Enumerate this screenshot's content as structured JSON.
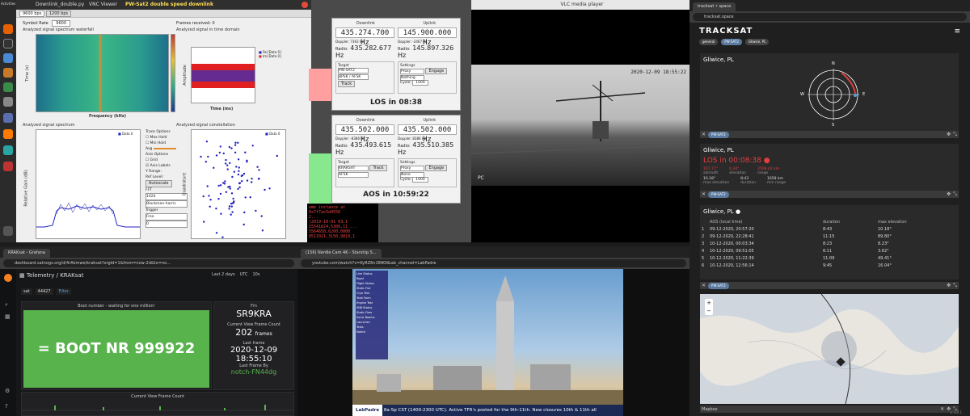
{
  "taskbar": {
    "label": "Activities",
    "icons": [
      "firefox-icon",
      "terminal-icon",
      "chrome-icon",
      "files-icon",
      "gnuradio-icon",
      "settings-icon",
      "text-editor-icon",
      "vlc-icon",
      "sdr-icon",
      "screenshot-icon",
      "apps-icon"
    ]
  },
  "gnuradio": {
    "window_title": "VNC Viewer",
    "file_tab": "Downlink_double.py",
    "title": "PW-Sat2 double speed downlink",
    "tabs": [
      "9600 bps",
      "1200 bps"
    ],
    "symbol_rate_label": "Symbol Rate",
    "symbol_rate": "9600",
    "frames_label": "Frames received: 0",
    "waterfall_title": "Analyzed signal spectrum waterfall",
    "waterfall_xlabel": "Frequency (kHz)",
    "waterfall_ylabel": "Time (s)",
    "time_title": "Analyzed signal in time domain",
    "time_xlabel": "Time (ms)",
    "time_ylabel": "Amplitude",
    "time_legend": [
      "Re{Data 0}",
      "Im{Data 0}"
    ],
    "spec_title": "Analyzed signal spectrum",
    "spec_ylabel": "Relative Gain (dB)",
    "spec_legend": "Data 0",
    "trace_options": "Trace Options",
    "max_hold": "Max Hold",
    "min_hold": "Min Hold",
    "avg": "Avg",
    "axis_options": "Axis Options",
    "grid": "Grid",
    "axis_labels": "Axis Labels",
    "y_range": "Y Range:",
    "ref_level": "Ref Level:",
    "autoscale": "Autoscale",
    "fft": "FFT",
    "fft_size": "1024",
    "window": "Blackman-harris",
    "trigger": "Trigger",
    "trigger_mode": "Free",
    "trigger_level": "0",
    "const_title": "Analyzed signal constellation",
    "const_ylabel": "Quadrature",
    "const_legend": "Data 0"
  },
  "doppler1": {
    "downlink": "Downlink",
    "uplink": "Uplink",
    "down_freq": "435.274.700 Hz",
    "up_freq": "145.900.000 Hz",
    "doppler_label": "Doppler:",
    "down_doppler": "7363 Hz",
    "up_doppler": "-2467 Hz",
    "radio_label": "Radio:",
    "down_radio": "435.282.677 Hz",
    "up_radio": "145.897.326 Hz",
    "target": "Target",
    "settings": "Settings",
    "sat": "PW-SAT2",
    "mode": "BPSK / AFSK",
    "track": "Track",
    "cycle": "Cycle:",
    "cycle_val": "1000",
    "engage": "Engage",
    "rx": "Proxy",
    "tx": "Nothing",
    "los": "LOS in 08:38"
  },
  "doppler2": {
    "downlink": "Downlink",
    "uplink": "Uplink",
    "down_freq": "435.502.000 Hz",
    "up_freq": "435.502.000 Hz",
    "doppler_label": "Doppler:",
    "down_doppler": "-8386 Hz",
    "up_doppler": "8386 Hz",
    "radio_label": "Radio:",
    "down_radio": "435.493.615 Hz",
    "up_radio": "435.510.385 Hz",
    "target": "Target",
    "settings": "Settings",
    "sat": "KRAKSAT",
    "mode": "AFSK",
    "track": "Track",
    "cycle": "Cycle:",
    "cycle_val": "1000",
    "engage": "Engage",
    "rx": "Proxy",
    "tx": "None",
    "los": "AOS in 10:59:22"
  },
  "terminal": {
    "lines": [
      "ame instance at 0x7f7ac5d4556",
      "",
      "2...",
      "(2019-10-01 03:1",
      "15541024,5300,11 ...",
      "5564658,6200,0000",
      "0511021,3150,9810,1"
    ]
  },
  "vlc": {
    "title": "VLC media player",
    "timestamp": "2020-12-09 18:55:22",
    "watermark": "PC"
  },
  "tracksat": {
    "tab_title": "tracksat • space",
    "url": "tracksat.space",
    "logo": "TRACKSAT",
    "filter_general": "general",
    "filter_sat": "PW-SAT2",
    "filter_loc": "Gliwice, PL",
    "polar_title": "Gliwice, PL",
    "compass": [
      "N",
      "E",
      "S",
      "W"
    ],
    "chip_sat": "PW-SAT2",
    "los_title": "Gliwice, PL",
    "los_text": "LOS in 00:08:38",
    "stats1": [
      {
        "value": "107.77°",
        "label": "azimuth"
      },
      {
        "value": "0.34°",
        "label": "elevation"
      },
      {
        "value": "2508.42 km",
        "label": "range"
      }
    ],
    "stats2": [
      {
        "value": "10.18°",
        "label": "max elevation"
      },
      {
        "value": "8:43",
        "label": "duration"
      },
      {
        "value": "1658 km",
        "label": "min range"
      }
    ],
    "passes_title": "Gliwice, PL",
    "passes_headers": [
      "",
      "AOS (local time)",
      "duration",
      "max elevation"
    ],
    "passes": [
      [
        "1",
        "09-12-2020, 20:57:20",
        "8:43",
        "10.18°"
      ],
      [
        "2",
        "09-12-2020, 22:28:41",
        "11:15",
        "89.80°"
      ],
      [
        "3",
        "10-12-2020, 00:03:34",
        "8:23",
        "8.23°"
      ],
      [
        "4",
        "10-12-2020, 09:51:05",
        "6:11",
        "3.62°"
      ],
      [
        "5",
        "10-12-2020, 11:22:39",
        "11:09",
        "49.41°"
      ],
      [
        "6",
        "10-12-2020, 12:56:14",
        "9:45",
        "16.04°"
      ]
    ],
    "map_footer": "Mapbox",
    "version": "v. 3.2.1"
  },
  "grafana": {
    "tab_title": "KRAKsat - Grafana",
    "url": "dashboard.satnogs.org/d/4rAkmwe/kraksat?orgId=1&from=now-2d&to=no...",
    "breadcrumb": "Telemetry / KRAKsat",
    "time_range": "Last 2 days",
    "time_zone": "UTC",
    "refresh": "10s",
    "var_sat": "sat",
    "var_norad": "44427",
    "filter": "Filter",
    "boot_title": "Boot number - waiting for one million!",
    "boot_value": "= BOOT NR 999922",
    "fm_title": "Fm",
    "fm_value": "SR9KRA",
    "count_title": "Current View Frame Count",
    "count_value": "202",
    "count_unit": "frames",
    "last_title": "Last frame",
    "last_value": "2020-12-09 18:55:10",
    "last_by": "Last Frame By",
    "last_by_value": "notch-FN44dg",
    "graph_title": "Current View Frame Count",
    "colors": {
      "boot": "#58b34d",
      "bg": "#161719"
    }
  },
  "youtube": {
    "tab_title": "(156) Nerdle Cam 4K - Starship S...",
    "url": "youtube.com/watch?v=KyRZ6ni3NKN&ab_channel=LabPadre",
    "ticker": "8a-5p CST (1400-2300 UTC). Active TFR's posted for the 9th-11th. New closures 10th & 11th all",
    "logo": "LabPadre",
    "overlay_lines": [
      "Live Status",
      "Road",
      "Flight Status",
      "Static Fire",
      "Cryo Test",
      "Tank Farm",
      "Engine Test",
      "SN8 Status",
      "Static Fires",
      "Sonic Booms",
      "Launches",
      "Tests",
      "Notice"
    ]
  }
}
